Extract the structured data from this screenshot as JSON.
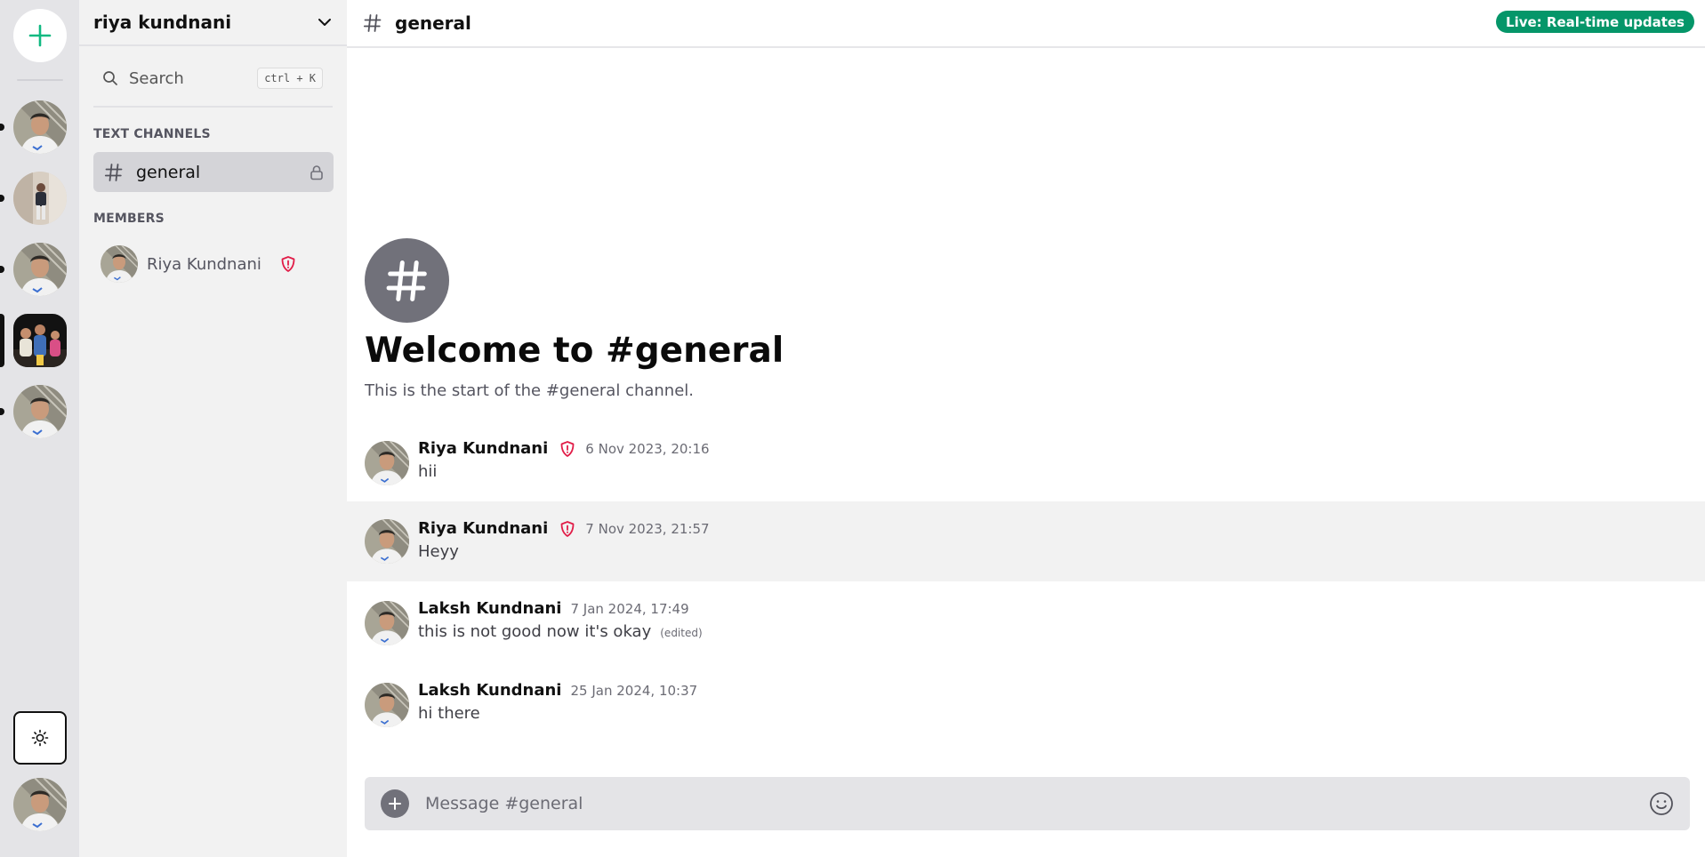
{
  "rail": {
    "add_icon": "plus-icon",
    "theme_icon": "sun-icon",
    "servers": [
      {
        "name": "server-1",
        "avatar": "avatar-photo-boy-cap",
        "active": false
      },
      {
        "name": "server-2",
        "avatar": "avatar-photo-standing-person",
        "active": false
      },
      {
        "name": "server-3",
        "avatar": "avatar-photo-boy-cap",
        "active": false
      },
      {
        "name": "server-4",
        "avatar": "avatar-photo-family",
        "active": true
      },
      {
        "name": "server-5",
        "avatar": "avatar-photo-boy-cap",
        "active": false
      }
    ]
  },
  "sidebar": {
    "server_name": "riya kundnani",
    "search": {
      "label": "Search",
      "shortcut": "ctrl + K"
    },
    "text_channels_title": "TEXT CHANNELS",
    "channels": [
      {
        "name": "general",
        "locked": true
      }
    ],
    "members_title": "MEMBERS",
    "members": [
      {
        "name": "Riya Kundnani",
        "role": "admin"
      }
    ]
  },
  "header": {
    "channel": "general",
    "badge": "Live: Real-time updates"
  },
  "welcome": {
    "title": "Welcome to #general",
    "subtitle": "This is the start of the #general channel."
  },
  "messages": [
    {
      "author": "Riya Kundnani",
      "admin": true,
      "time": "6 Nov 2023, 20:16",
      "text": "hii",
      "edited": ""
    },
    {
      "author": "Riya Kundnani",
      "admin": true,
      "time": "7 Nov 2023, 21:57",
      "text": "Heyy",
      "edited": ""
    },
    {
      "author": "Laksh Kundnani",
      "admin": false,
      "time": "7 Jan 2024, 17:49",
      "text": "this is not good now it's okay",
      "edited": "(edited)"
    },
    {
      "author": "Laksh Kundnani",
      "admin": false,
      "time": "25 Jan 2024, 10:37",
      "text": "hi there",
      "edited": ""
    }
  ],
  "composer": {
    "placeholder": "Message #general"
  },
  "colors": {
    "accent": "#10b981",
    "live_badge": "#059669",
    "admin_shield": "#e11d48",
    "hash_circle": "#71717a"
  }
}
